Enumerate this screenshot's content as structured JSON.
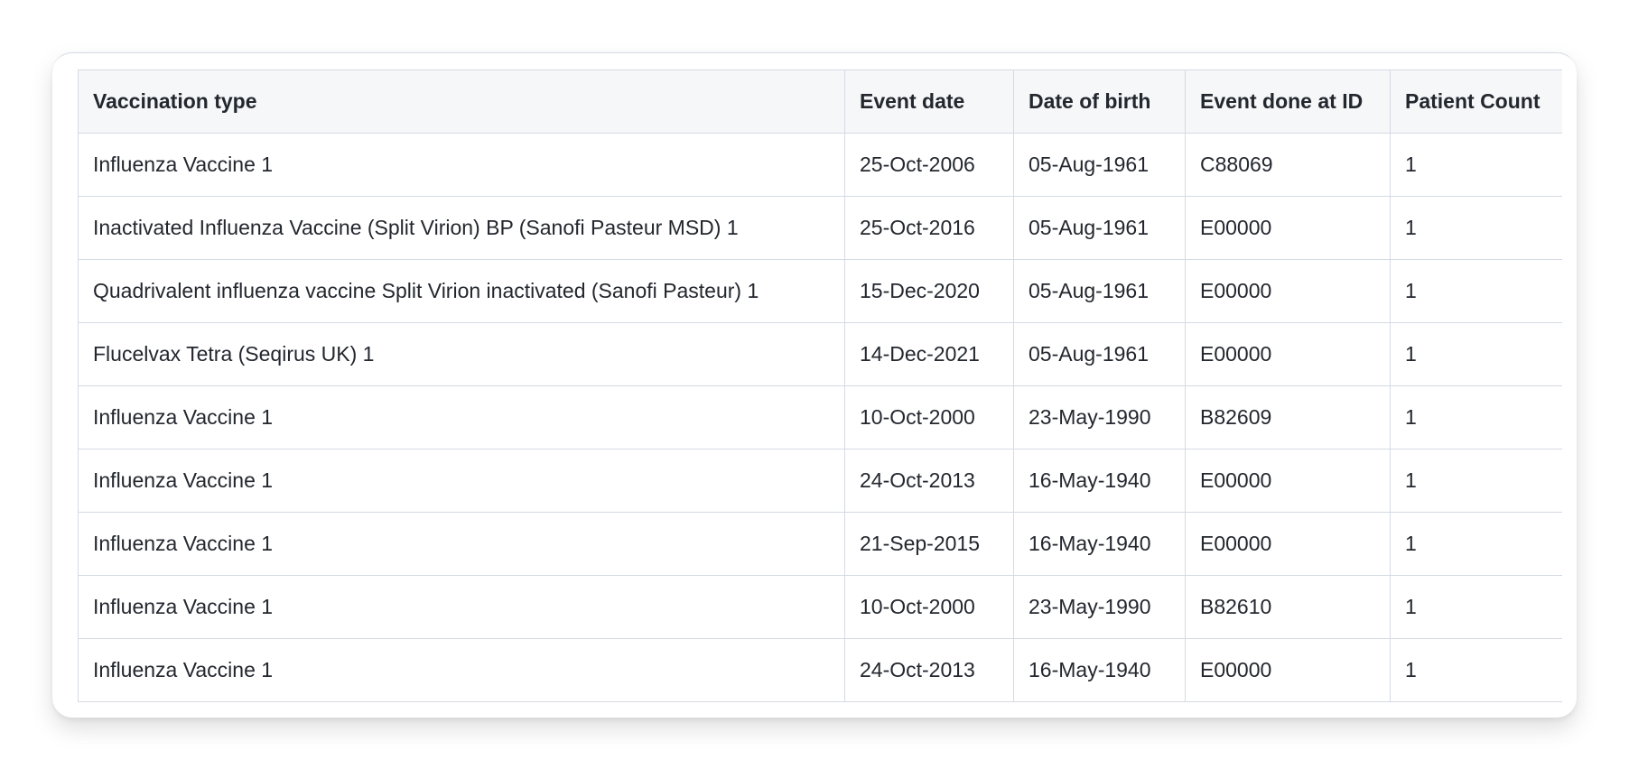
{
  "table": {
    "columns": [
      "Vaccination type",
      "Event date",
      "Date of birth",
      "Event done at ID",
      "Patient Count"
    ],
    "rows": [
      [
        "Influenza Vaccine 1",
        "25-Oct-2006",
        "05-Aug-1961",
        "C88069",
        "1"
      ],
      [
        "Inactivated Influenza Vaccine (Split Virion) BP (Sanofi Pasteur MSD) 1",
        "25-Oct-2016",
        "05-Aug-1961",
        "E00000",
        "1"
      ],
      [
        "Quadrivalent influenza vaccine Split Virion inactivated (Sanofi Pasteur) 1",
        "15-Dec-2020",
        "05-Aug-1961",
        "E00000",
        "1"
      ],
      [
        "Flucelvax Tetra (Seqirus UK) 1",
        "14-Dec-2021",
        "05-Aug-1961",
        "E00000",
        "1"
      ],
      [
        "Influenza Vaccine 1",
        "10-Oct-2000",
        "23-May-1990",
        "B82609",
        "1"
      ],
      [
        "Influenza Vaccine 1",
        "24-Oct-2013",
        "16-May-1940",
        "E00000",
        "1"
      ],
      [
        "Influenza Vaccine 1",
        "21-Sep-2015",
        "16-May-1940",
        "E00000",
        "1"
      ],
      [
        "Influenza Vaccine 1",
        "10-Oct-2000",
        "23-May-1990",
        "B82610",
        "1"
      ],
      [
        "Influenza Vaccine 1",
        "24-Oct-2013",
        "16-May-1940",
        "E00000",
        "1"
      ]
    ]
  }
}
